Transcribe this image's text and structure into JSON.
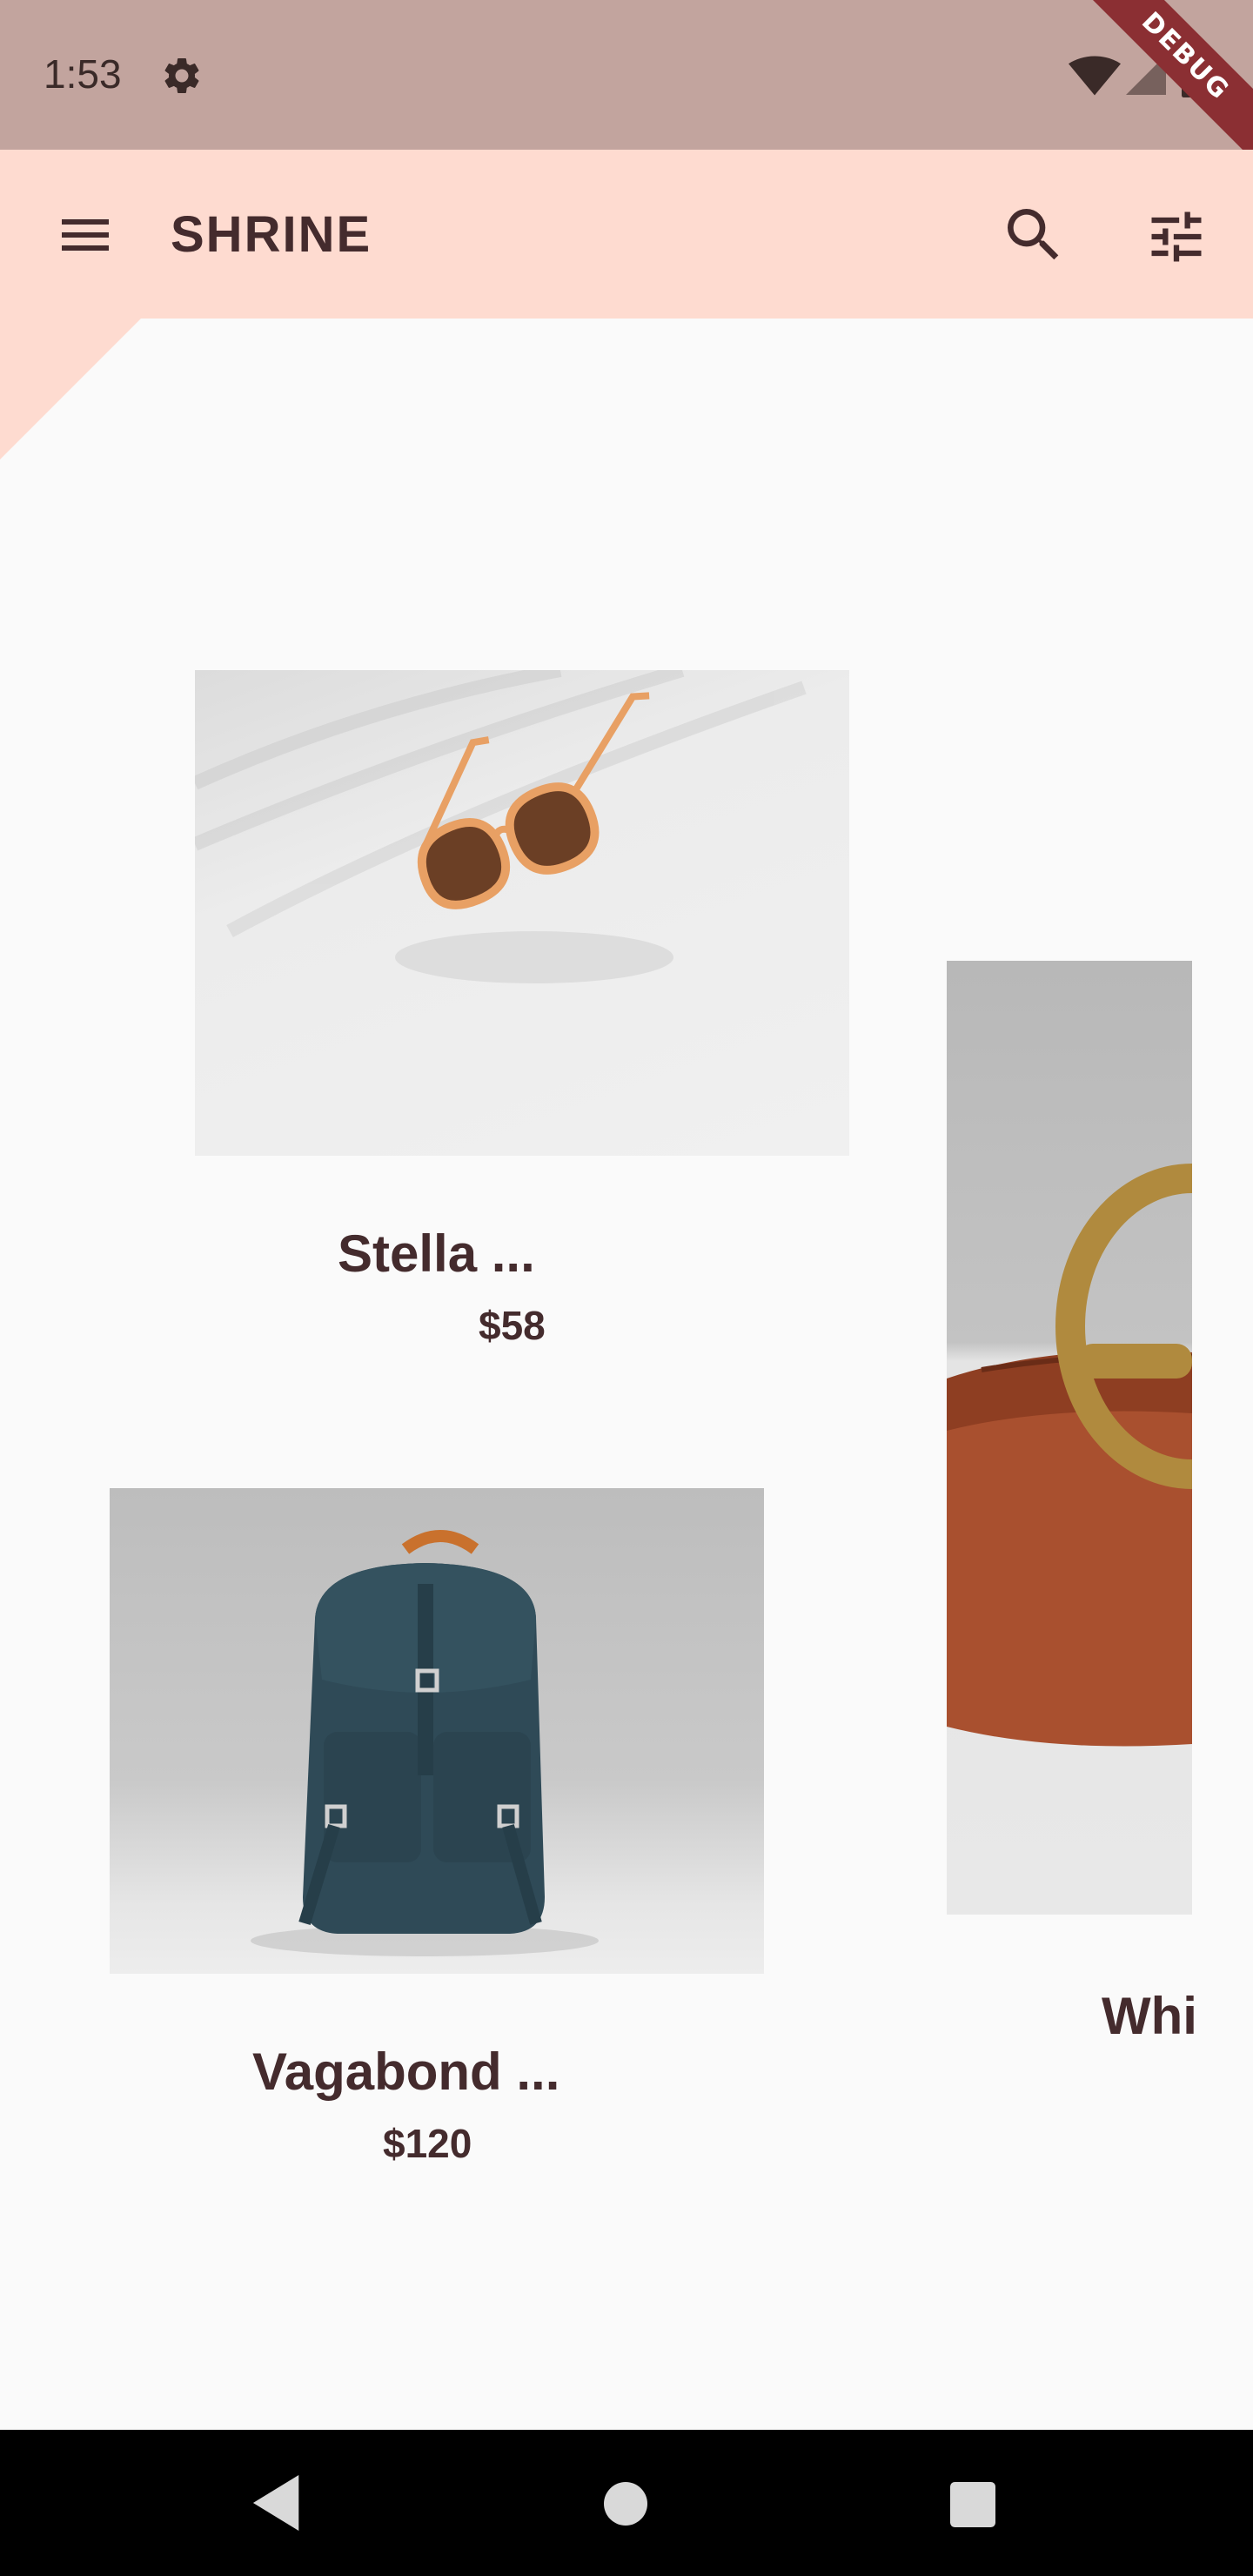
{
  "status_bar": {
    "time": "1:53",
    "debug_label": "DEBUG",
    "icons": [
      "gear-icon",
      "wifi-icon",
      "cell-signal-icon",
      "battery-icon"
    ]
  },
  "app_bar": {
    "title": "SHRINE",
    "icons": [
      "menu-icon",
      "search-icon",
      "tune-icon"
    ],
    "background": "#fedbd0",
    "text_color": "#442b2d"
  },
  "products": [
    {
      "name": "Stella ...",
      "price": "$58",
      "image": "sunglasses"
    },
    {
      "name": "Vagabond ...",
      "price": "$120",
      "image": "backpack"
    },
    {
      "name": "Whi",
      "price": "",
      "image": "belt"
    }
  ],
  "nav_bar": {
    "icons": [
      "back-icon",
      "home-icon",
      "recents-icon"
    ]
  },
  "colors": {
    "status_bar": "#c2a49e",
    "background": "#fafafa",
    "debug_banner": "#8b2f33"
  }
}
